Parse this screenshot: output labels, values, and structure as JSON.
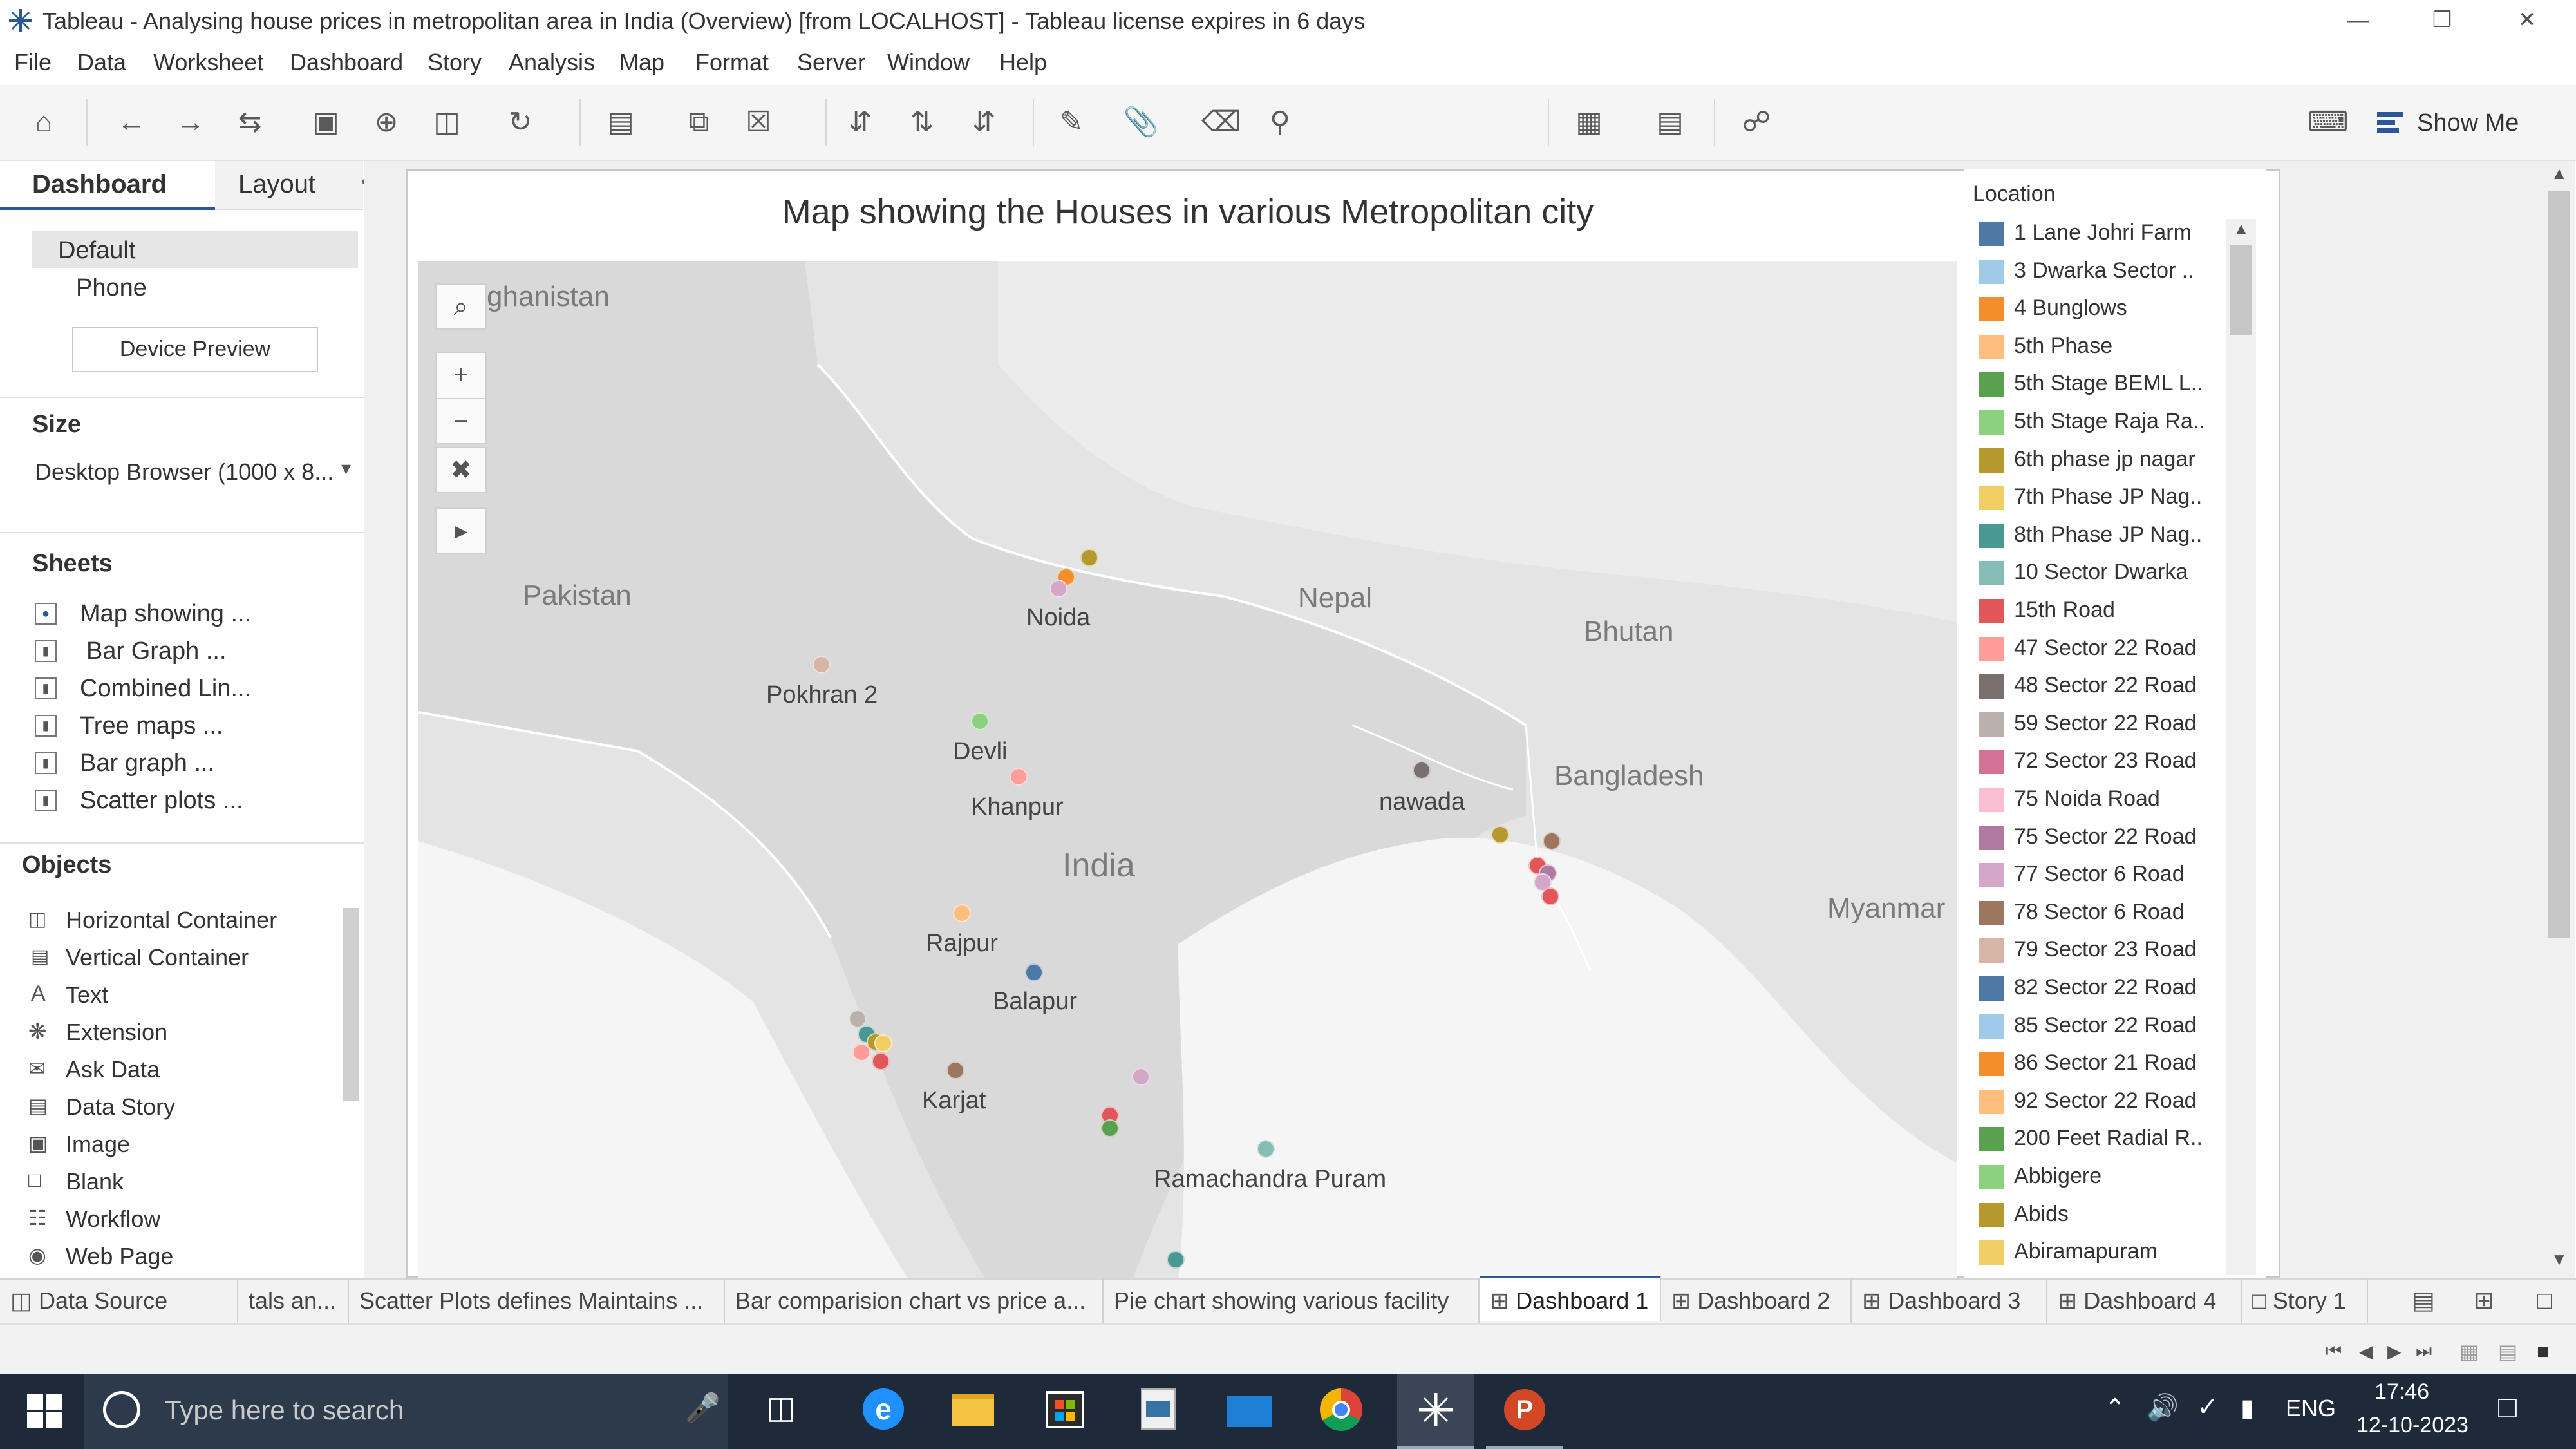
{
  "window": {
    "title": "Tableau - Analysing house prices in metropolitan area in India (Overview) [from LOCALHOST] - Tableau license expires in 6 days",
    "app_icon": "tableau-logo-icon"
  },
  "menu": [
    "File",
    "Data",
    "Worksheet",
    "Dashboard",
    "Story",
    "Analysis",
    "Map",
    "Format",
    "Server",
    "Window",
    "Help"
  ],
  "toolbar": {
    "show_me_label": "Show Me"
  },
  "left_panel": {
    "tabs": {
      "dashboard": "Dashboard",
      "layout": "Layout"
    },
    "device": {
      "default": "Default",
      "phone": "Phone",
      "preview_button": "Device Preview"
    },
    "size": {
      "heading": "Size",
      "value": "Desktop Browser (1000 x 8..."
    },
    "sheets": {
      "heading": "Sheets",
      "items": [
        "Map showing ...",
        "Bar Graph ...",
        "Combined Lin...",
        "Tree maps ...",
        "Bar graph ...",
        "Scatter plots ..."
      ]
    },
    "objects": {
      "heading": "Objects",
      "items": [
        "Horizontal Container",
        "Vertical Container",
        "Text",
        "Extension",
        "Ask Data",
        "Data Story",
        "Image",
        "Blank",
        "Workflow",
        "Web Page"
      ]
    }
  },
  "dashboard": {
    "title": "Map showing the Houses in various Metropolitan city",
    "map_countries": [
      "ghanistan",
      "Pakistan",
      "Nepal",
      "Bhutan",
      "Bangladesh",
      "India",
      "Myanmar"
    ],
    "map_cities": [
      "Noida",
      "Pokhran 2",
      "Devli",
      "Khanpur",
      "nawada",
      "Rajpur",
      "Balapur",
      "Karjat",
      "Ramachandra Puram"
    ],
    "dot_colors": [
      "#4e79a7",
      "#f28e2b",
      "#b5962d",
      "#d4a68a",
      "#59a14f",
      "#ff9d9a",
      "#79706e",
      "#e15759",
      "#c66fa5",
      "#d6a0c7",
      "#f7b46a",
      "#9c755f",
      "#499894",
      "#86bcb6",
      "#b9a7a0"
    ]
  },
  "legend": {
    "title": "Location",
    "items": [
      {
        "label": "1 Lane Johri Farm",
        "color": "#4e79a7"
      },
      {
        "label": "3 Dwarka Sector ..",
        "color": "#a0cbe8"
      },
      {
        "label": "4 Bunglows",
        "color": "#f28e2b"
      },
      {
        "label": "5th Phase",
        "color": "#ffbe7d"
      },
      {
        "label": "5th Stage BEML L..",
        "color": "#59a14f"
      },
      {
        "label": "5th Stage Raja Ra..",
        "color": "#8cd17d"
      },
      {
        "label": "6th phase jp nagar",
        "color": "#b6992d"
      },
      {
        "label": "7th Phase JP Nag..",
        "color": "#f1ce63"
      },
      {
        "label": "8th Phase JP Nag..",
        "color": "#499894"
      },
      {
        "label": "10 Sector Dwarka",
        "color": "#86bcb6"
      },
      {
        "label": "15th Road",
        "color": "#e15759"
      },
      {
        "label": "47 Sector 22 Road",
        "color": "#ff9d9a"
      },
      {
        "label": "48 Sector 22 Road",
        "color": "#79706e"
      },
      {
        "label": "59 Sector 22 Road",
        "color": "#bab0ac"
      },
      {
        "label": "72 Sector 23 Road",
        "color": "#d37295"
      },
      {
        "label": "75 Noida Road",
        "color": "#fabfd2"
      },
      {
        "label": "75 Sector 22 Road",
        "color": "#b07aa1"
      },
      {
        "label": "77 Sector 6 Road",
        "color": "#d4a6c8"
      },
      {
        "label": "78 Sector 6 Road",
        "color": "#9d7660"
      },
      {
        "label": "79 Sector 23 Road",
        "color": "#d7b5a6"
      },
      {
        "label": "82 Sector 22 Road",
        "color": "#4e79a7"
      },
      {
        "label": "85 Sector 22 Road",
        "color": "#a0cbe8"
      },
      {
        "label": "86 Sector 21 Road",
        "color": "#f28e2b"
      },
      {
        "label": "92 Sector 22 Road",
        "color": "#ffbe7d"
      },
      {
        "label": "200 Feet Radial R..",
        "color": "#59a14f"
      },
      {
        "label": "Abbigere",
        "color": "#8cd17d"
      },
      {
        "label": "Abids",
        "color": "#b6992d"
      },
      {
        "label": "Abiramapuram",
        "color": "#f1ce63"
      }
    ]
  },
  "bottom_tabs": {
    "data_source": "Data Source",
    "sheets": [
      "tals an...",
      "Scatter Plots defines Maintains ...",
      "Bar comparision chart vs price a...",
      "Pie chart showing various facility"
    ],
    "dashboards": [
      "Dashboard 1",
      "Dashboard 2",
      "Dashboard 3",
      "Dashboard 4"
    ],
    "story": "Story 1",
    "active": "Dashboard 1"
  },
  "taskbar": {
    "search_placeholder": "Type here to search",
    "language": "ENG",
    "time": "17:46",
    "date": "12-10-2023"
  }
}
